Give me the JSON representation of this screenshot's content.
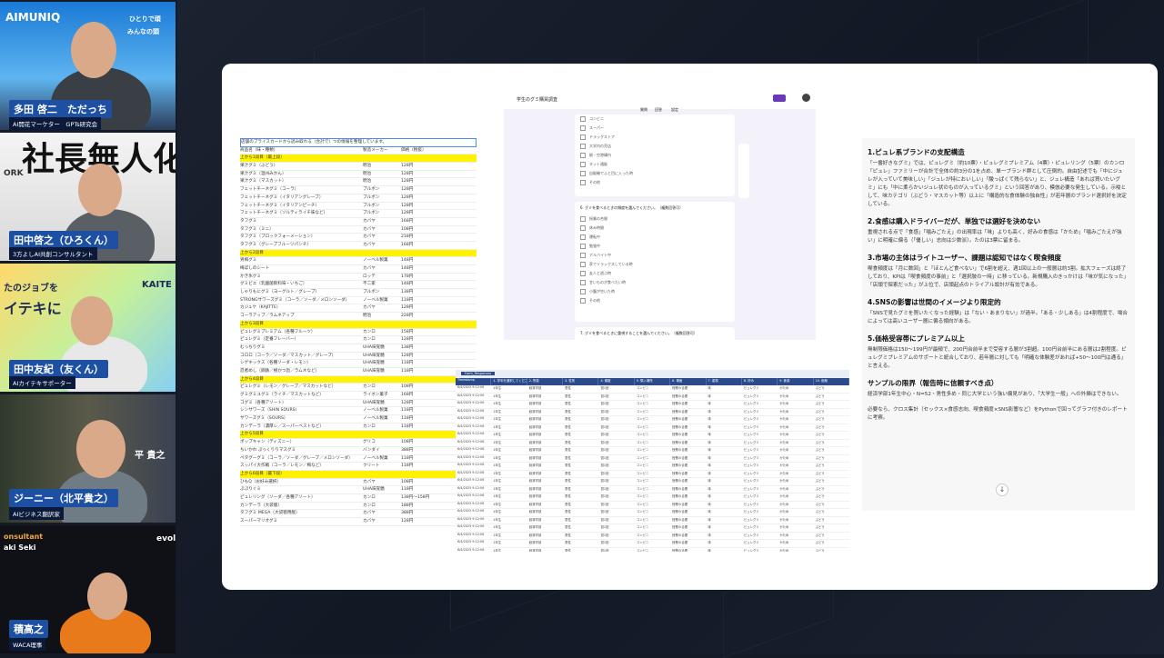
{
  "participants": [
    {
      "name": "多田 啓二　ただっち",
      "role": "AI開花マーケター　GPTs研究会",
      "banner": "AIMUNIQ",
      "banner_sub": "ひとりで頑",
      "banner_sub2": "みんなの頭"
    },
    {
      "name": "田中啓之（ひろくん）",
      "role": "3方よしAI共創コンサルタント",
      "banner": "社長無人化",
      "banner_sub": "ORK"
    },
    {
      "name": "田中友紀（友くん）",
      "role": "AIカイテキサポーター",
      "banner": "たのジョブを",
      "banner_sub": "イテキに",
      "banner_sub2": "KAITE"
    },
    {
      "name": "ジーニー（北平貴之）",
      "role": "AIビジネス翻訳家",
      "banner": "平 貴之"
    },
    {
      "name": "積高之",
      "role": "WACA理事",
      "banner": "onsultant",
      "banner_sub": "aki Seki",
      "banner_sub2": "evolu"
    }
  ],
  "form": {
    "title": "学生のグミ購買調査",
    "tabs": [
      "質問",
      "回答",
      "設定"
    ],
    "options1": [
      "コンビニ",
      "スーパー",
      "ドラッグストア",
      "大学内の売店",
      "駅・空港構内",
      "ネット通販",
      "自販機でふと目に入った時",
      "その他"
    ],
    "q2": "6. グミを食べるときの頻度を選んでください。（複数回答可）",
    "options2": [
      "授業の合間",
      "休み時間",
      "運転中",
      "勉強中",
      "アルバイト中",
      "家でリラックスしている時",
      "友人と遊ぶ時",
      "甘いものが食べたい時",
      "小腹が空いた時",
      "その他"
    ],
    "q3": "7. グミを食べるときに重視することを選んでください。（複数回答可）"
  },
  "sheet": {
    "note": "店舗のプライスカードから読み取れる（合計で）つの情報を整理しています。",
    "headers": [
      "商品名（味・種類）",
      "製造メーカー",
      "価格（税抜）"
    ],
    "rows": [
      {
        "hl": true,
        "a": "上から1段目（最上段）",
        "b": "",
        "c": ""
      },
      {
        "hl": false,
        "a": "果汁グミ（ぶどう）",
        "b": "明治",
        "c": "128円"
      },
      {
        "hl": false,
        "a": "果汁グミ（温州みかん）",
        "b": "明治",
        "c": "128円"
      },
      {
        "hl": false,
        "a": "果汁グミ（マスカット）",
        "b": "明治",
        "c": "128円"
      },
      {
        "hl": false,
        "a": "フェットチーネグミ（コーラ）",
        "b": "ブルボン",
        "c": "128円"
      },
      {
        "hl": false,
        "a": "フェットチーネグミ（イタリアングレープ）",
        "b": "ブルボン",
        "c": "128円"
      },
      {
        "hl": false,
        "a": "フェットチーネグミ（イタリアンピーチ）",
        "b": "ブルボン",
        "c": "128円"
      },
      {
        "hl": false,
        "a": "フェットチーネグミ（ソルティライチ味など）",
        "b": "ブルボン",
        "c": "128円"
      },
      {
        "hl": false,
        "a": "タフグミ",
        "b": "カバヤ",
        "c": "168円"
      },
      {
        "hl": false,
        "a": "タフグミ（ミニ）",
        "b": "カバヤ",
        "c": "108円"
      },
      {
        "hl": false,
        "a": "タフグミ（ブロックフォーメーション）",
        "b": "カバヤ",
        "c": "218円"
      },
      {
        "hl": false,
        "a": "タフグミ（グレープフルーツパンチ）",
        "b": "カバヤ",
        "c": "168円"
      },
      {
        "hl": true,
        "a": "上から2段目",
        "b": "",
        "c": ""
      },
      {
        "hl": false,
        "a": "男梅グミ",
        "b": "ノーベル製菓",
        "c": "148円"
      },
      {
        "hl": false,
        "a": "梅ぼしのシート",
        "b": "カバヤ",
        "c": "148円"
      },
      {
        "hl": false,
        "a": "かき氷グミ",
        "b": "ロッテ",
        "c": "178円"
      },
      {
        "hl": false,
        "a": "グミビエ（乳酸菌飲料味・いちご）",
        "b": "不二家",
        "c": "148円"
      },
      {
        "hl": false,
        "a": "しゃりもにグミ（ヨーグルト／グレープ）",
        "b": "ブルボン",
        "c": "138円"
      },
      {
        "hl": false,
        "a": "STRONGサワーズグミ（コーラ／ソーダ／メロンソーダ）",
        "b": "ノーベル製菓",
        "c": "118円"
      },
      {
        "hl": false,
        "a": "カジュケ（KAJITTE）",
        "b": "カバヤ",
        "c": "128円"
      },
      {
        "hl": false,
        "a": "コーラアップ／ラムネアップ",
        "b": "明治",
        "c": "228円"
      },
      {
        "hl": true,
        "a": "上から3段目",
        "b": "",
        "c": ""
      },
      {
        "hl": false,
        "a": "ピュレグミプレミアム（各種フルーツ）",
        "b": "カンロ",
        "c": "158円"
      },
      {
        "hl": false,
        "a": "ピュレグミ（定番フレーバー）",
        "b": "カンロ",
        "c": "128円"
      },
      {
        "hl": false,
        "a": "むっちりグミ",
        "b": "UHA味覚糖",
        "c": "138円"
      },
      {
        "hl": false,
        "a": "コロロ（コーラ／ソーダ／マスカット／グレープ）",
        "b": "UHA味覚糖",
        "c": "128円"
      },
      {
        "hl": false,
        "a": "シゲキックス（各種ソーダ・レモン）",
        "b": "UHA味覚糖",
        "c": "118円"
      },
      {
        "hl": false,
        "a": "忍者めし（鋼鉄／極かつ旨／ラムネなど）",
        "b": "UHA味覚糖",
        "c": "118円"
      },
      {
        "hl": true,
        "a": "上から4段目",
        "b": "",
        "c": ""
      },
      {
        "hl": false,
        "a": "ピュレグミ（レモン／グレープ／マスカットなど）",
        "b": "カンロ",
        "c": "108円"
      },
      {
        "hl": false,
        "a": "グミグミユグミ（ライチ／マスカットなど）",
        "b": "ライオン菓子",
        "c": "168円"
      },
      {
        "hl": false,
        "a": "コグミ（各種アソート）",
        "b": "UHA味覚糖",
        "c": "128円"
      },
      {
        "hl": false,
        "a": "シンサワーズ（SHIN SOURS）",
        "b": "ノーベル製菓",
        "c": "118円"
      },
      {
        "hl": false,
        "a": "サワーズグミ（SOURS）",
        "b": "ノーベル製菓",
        "c": "118円"
      },
      {
        "hl": false,
        "a": "カンデーラ（濃厚レ／スーパーベストなど）",
        "b": "カンロ",
        "c": "118円"
      },
      {
        "hl": true,
        "a": "上から5段目",
        "b": "",
        "c": ""
      },
      {
        "hl": false,
        "a": "ポップキャン（ディズニー）",
        "b": "グリコ",
        "c": "108円"
      },
      {
        "hl": false,
        "a": "ちいかわ ぷっくりりマスグミ",
        "b": "バンダイ",
        "c": "388円"
      },
      {
        "hl": false,
        "a": "ペタグーグミ（コーラ／ソーダ／グレープ／メロンソーダ）",
        "b": "ノーベル製菓",
        "c": "118円"
      },
      {
        "hl": false,
        "a": "スッパイ大作戦（コーラ／レモン／梅など）",
        "b": "クリート",
        "c": "118円"
      },
      {
        "hl": true,
        "a": "上から6段目（最下段）",
        "b": "",
        "c": ""
      },
      {
        "hl": false,
        "a": "ひもQ（お好み選択）",
        "b": "カバヤ",
        "c": "108円"
      },
      {
        "hl": false,
        "a": "ぷぷりぐミ",
        "b": "UHA味覚糖",
        "c": "118円"
      },
      {
        "hl": false,
        "a": "ピュレリング（ソーダ／各種アソート）",
        "b": "カンロ",
        "c": "138円〜158円"
      },
      {
        "hl": false,
        "a": "カンデーラ（大袋版）",
        "b": "カンロ",
        "c": "188円"
      },
      {
        "hl": false,
        "a": "タフグミ MEGA（大袋徳用版）",
        "b": "カバヤ",
        "c": "388円"
      },
      {
        "hl": false,
        "a": "スーパーマリオグミ",
        "b": "カバヤ",
        "c": "128円"
      }
    ]
  },
  "responses": {
    "tab": "Form_Responses",
    "headers": [
      "Timestamp",
      "1. 学年を選択してください",
      "2. 所属",
      "3. 性別",
      "4. 頻度",
      "5. 購入場所",
      "6. 場面",
      "7. 重視",
      "8. 好み",
      "9. 食感",
      "10. 価格"
    ],
    "row": [
      "6/4/2025 9:12:06",
      "1年生",
      "経済学部",
      "男性",
      "週1回",
      "コンビニ",
      "授業の合間",
      "味",
      "ピュレグミ",
      "かため",
      "ぶどう"
    ]
  },
  "analysis": {
    "sections": [
      {
        "title": "1.ピュレ系ブランドの支配構造",
        "body": "「一番好きなグミ」では、ピュレグミ（約10票）・ピュレグミプレミアム（4票）・ピュレリング（5票）のカンロ「ピュレ」ファミリーが合計で全体の約3分の1を占め、単一ブランド群として圧倒的。自由記述でも「中にジュレが入っていて美味しい」「ジュレが特においしい」「酸っぱくて残らない」と、ジュレ構造「あれば買いたいグミ」にも「中に柔らかいジュレ状のものが入っているグミ」という回答があり、模倣必要な発生している。示唆として、味カテゴリ（ぶどう・マスカット等）以上に「構造的な食体験の独自性」が若年層のブランド選択好を決定している。"
      },
      {
        "title": "2.食感は購入ドライバーだが、単独では選好を決めない",
        "body": "重視される点で「食感」「噛みごたえ」の出現率は「味」よりも高く、好みの食感は「かため」「噛みごたえが強い」に明確に偏る（「優しい」志向は少数派）。たのは3票に留まる。"
      },
      {
        "title": "3.市場の主体はライトユーザー、課題は認知ではなく喫食頻度",
        "body": "喫食頻度は「月に数回」と「ほとんど食べない」で6割を超え、週1回以上の一般層は約3割。拡大フェーズは終了しており、KPIは「喫食頻度の事前」と「選択肢の一時」に移っている。新規購入のきっかけは「味が気になった」「店頭で探索だった」が上位で、店頭起点のトライアル設計が有効である。"
      },
      {
        "title": "4.SNSの影響は世間のイメージより限定的",
        "body": "「SNSで見たグミを買いたくなった経験」は「ない・あまりない」が過半。「ある・少しある」は4割程度で、場合によっては高いユーザー層に偏る傾向がある。"
      },
      {
        "title": "5.価格受容帯にプレミアム以上",
        "body": "無制限価格は150〜199円が最頻で、200円台前半まで受容する層が3割超。100円台前半にある層は2割程度。ピュレグミプレミアムのサポートと統合しており、若年層に対しても「明確な体験差があれば+50〜100円は通る」と言える。"
      },
      {
        "title": "サンプルの限界（報告時に信頼すべき点）",
        "body": "経済学部1年生中心・N=52・男性多め・同じ大学という強い偏見があり、「大学生一般」への外挿はできない。"
      },
      {
        "title": "",
        "body": "必要なら、クロス集計（セックス×食感志向、喫食頻度×SNS影響など）をPythonで回ってグラフ付きのレポートに考察。"
      }
    ]
  }
}
